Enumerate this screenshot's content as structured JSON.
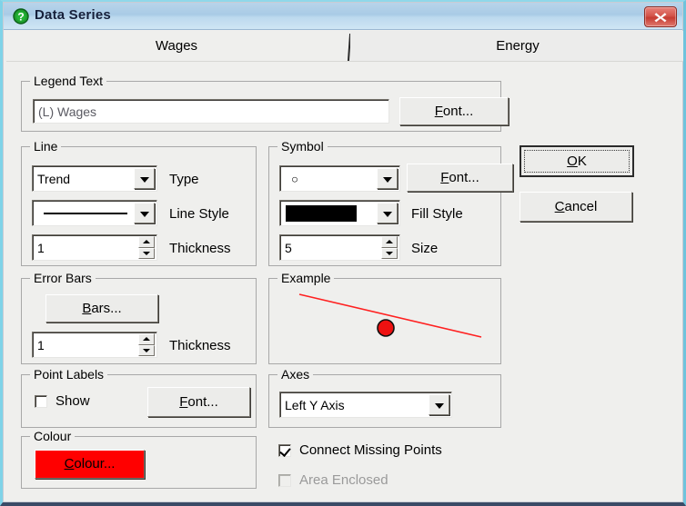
{
  "window": {
    "title": "Data Series",
    "icon": "question-mark-icon",
    "close_label": "x",
    "frame_color": "#7fd3e8",
    "titlebar_color": "#a9cbe6",
    "close_color": "#c63c32"
  },
  "tabs": [
    {
      "label": "Wages",
      "active": true
    },
    {
      "label": "Energy",
      "active": false
    }
  ],
  "legend_text": {
    "group_label": "Legend Text",
    "value": "(L) Wages",
    "placeholder": "",
    "font_button": "Font..."
  },
  "line": {
    "group_label": "Line",
    "type": {
      "value": "Trend",
      "label": "Type"
    },
    "line_style": {
      "value": "solid",
      "label": "Line Style"
    },
    "thickness": {
      "value": "1",
      "label": "Thickness"
    }
  },
  "symbol": {
    "group_label": "Symbol",
    "shape": {
      "value": "○"
    },
    "font_button": "Font...",
    "fill_style": {
      "value": "solid-black",
      "label": "Fill Style",
      "color": "#000000"
    },
    "size": {
      "value": "5",
      "label": "Size"
    }
  },
  "error_bars": {
    "group_label": "Error Bars",
    "bars_button": "Bars...",
    "thickness": {
      "value": "1",
      "label": "Thickness"
    }
  },
  "example": {
    "group_label": "Example",
    "line_color": "#ff2020",
    "marker_color": "#ee1111",
    "marker_border": "#000000"
  },
  "point_labels": {
    "group_label": "Point Labels",
    "show": {
      "label": "Show",
      "checked": false
    },
    "font_button": "Font..."
  },
  "colour": {
    "group_label": "Colour",
    "button": "Colour...",
    "value": "#ff0000"
  },
  "axes": {
    "group_label": "Axes",
    "value": "Left Y Axis"
  },
  "options": {
    "connect_missing_points": {
      "label": "Connect Missing Points",
      "checked": true,
      "disabled": false
    },
    "area_enclosed": {
      "label": "Area Enclosed",
      "checked": false,
      "disabled": true
    }
  },
  "actions": {
    "ok": "OK",
    "cancel": "Cancel"
  }
}
